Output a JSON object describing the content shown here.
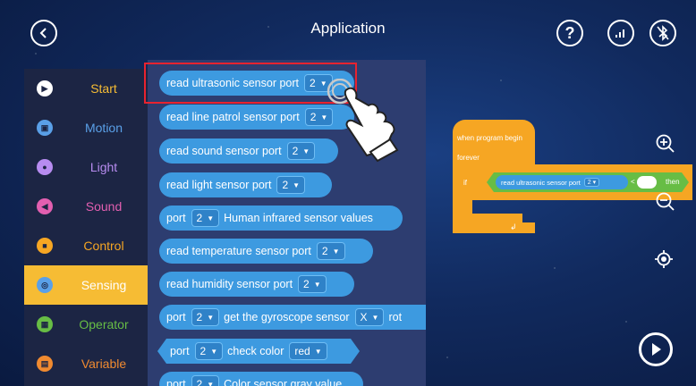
{
  "app": {
    "title": "Application"
  },
  "sidebar": {
    "items": [
      {
        "label": "Start",
        "icon": "play-icon",
        "color": "#ffffff",
        "text_color": "#f6bc34"
      },
      {
        "label": "Motion",
        "icon": "car-icon",
        "color": "#5aa0e8",
        "text_color": "#5aa0e8"
      },
      {
        "label": "Light",
        "icon": "bulb-icon",
        "color": "#b78cf0",
        "text_color": "#b78cf0"
      },
      {
        "label": "Sound",
        "icon": "speaker-icon",
        "color": "#e25fb0",
        "text_color": "#e25fb0"
      },
      {
        "label": "Control",
        "icon": "gamepad-icon",
        "color": "#f6a623",
        "text_color": "#f6a623"
      },
      {
        "label": "Sensing",
        "icon": "sensor-icon",
        "color": "#5aa0e8",
        "text_color": "#ffffff"
      },
      {
        "label": "Operator",
        "icon": "calculator-icon",
        "color": "#67bd45",
        "text_color": "#67bd45"
      },
      {
        "label": "Variable",
        "icon": "variable-icon",
        "color": "#f08a30",
        "text_color": "#f08a30"
      }
    ],
    "active": "Sensing"
  },
  "palette": {
    "blocks": [
      {
        "text": "read ultrasonic sensor  port",
        "value": "2"
      },
      {
        "text": "read line patrol sensor  port",
        "value": "2"
      },
      {
        "text": "read sound  sensor port",
        "value": "2"
      },
      {
        "text": "read light  sensor  port",
        "value": "2"
      },
      {
        "pre": "port",
        "value": "2",
        "text": "Human infrared sensor values"
      },
      {
        "text": "read temperature  sensor  port",
        "value": "2"
      },
      {
        "text": "read humidity  sensor port",
        "value": "2"
      },
      {
        "pre": "port",
        "value": "2",
        "text": "get the gyroscope sensor",
        "value2": "X",
        "post": "rot"
      },
      {
        "pre": "port",
        "value": "2",
        "text": "check color",
        "value2": "red"
      },
      {
        "pre": "port",
        "value": "2",
        "text": "Color sensor gray value"
      }
    ]
  },
  "workspace": {
    "hat": "when program begin",
    "loop": "forever",
    "if": "if",
    "then": "then",
    "sensor": "read ultrasonic sensor  port",
    "port": "2",
    "op": "<"
  },
  "colors": {
    "accent": "#f6bc34",
    "block": "#3d9ae0",
    "highlight": "#e8232f"
  }
}
